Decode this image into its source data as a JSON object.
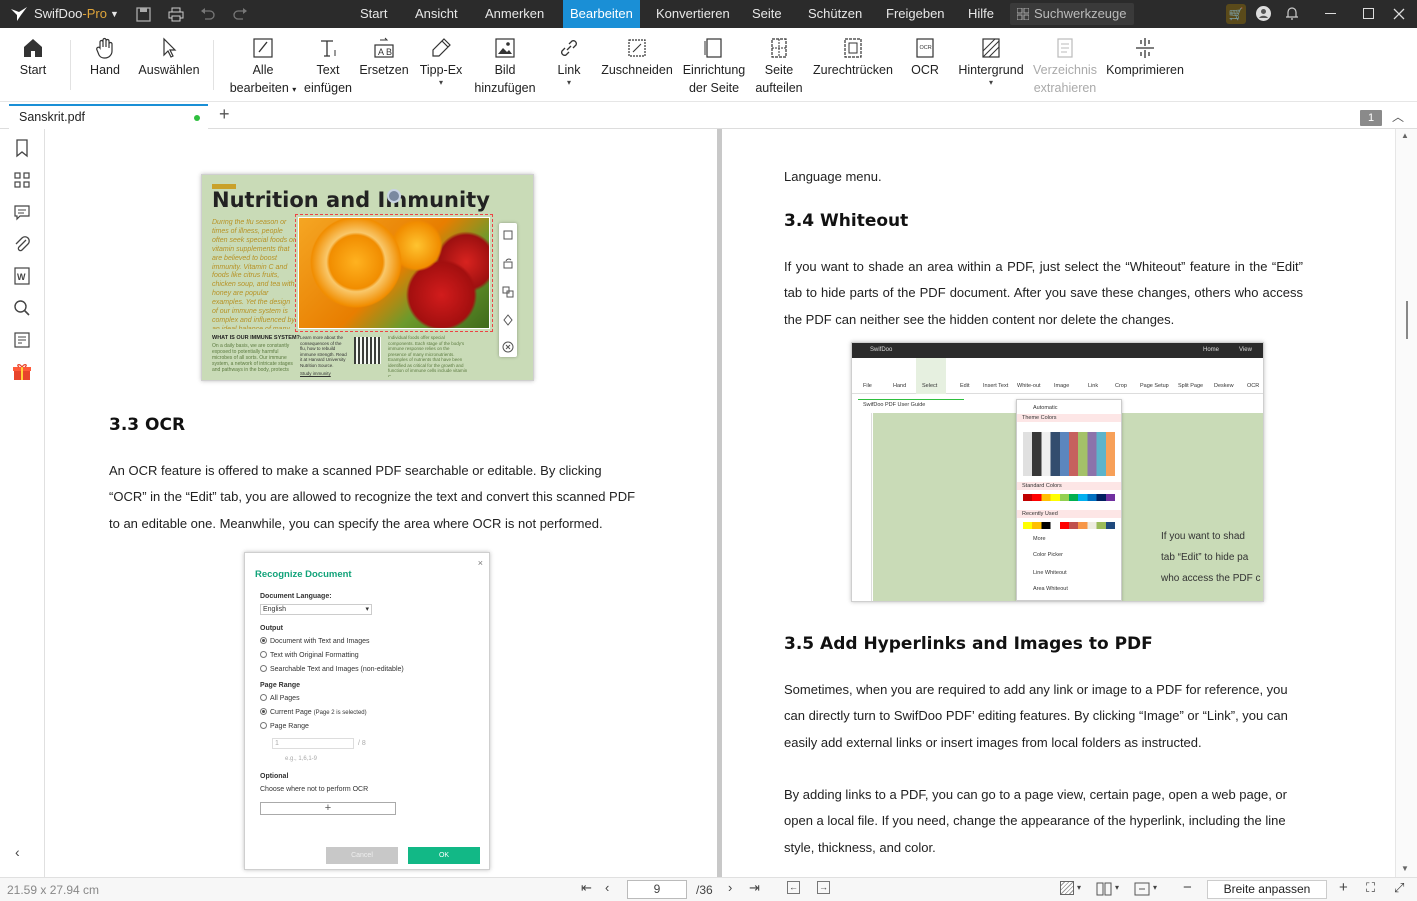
{
  "app": {
    "name": "SwifDoo",
    "edition": "-Pro",
    "search_placeholder": "Suchwerkzeuge"
  },
  "menu": [
    "Start",
    "Ansicht",
    "Anmerken",
    "Bearbeiten",
    "Konvertieren",
    "Seite",
    "Schützen",
    "Freigeben",
    "Hilfe"
  ],
  "active_menu": "Bearbeiten",
  "ribbon": [
    {
      "label": "Start",
      "label2": "",
      "icon": "home-icon"
    },
    {
      "label": "Hand",
      "label2": "",
      "icon": "hand-icon"
    },
    {
      "label": "Auswählen",
      "label2": "",
      "icon": "cursor-icon"
    },
    {
      "label": "Alle",
      "label2": "bearbeiten",
      "icon": "edit-all-icon",
      "dropdown": true
    },
    {
      "label": "Text",
      "label2": "einfügen",
      "icon": "text-insert-icon"
    },
    {
      "label": "Ersetzen",
      "label2": "",
      "icon": "replace-icon"
    },
    {
      "label": "Tipp-Ex",
      "label2": "",
      "icon": "whiteout-icon",
      "dropdown": true
    },
    {
      "label": "Bild",
      "label2": "hinzufügen",
      "icon": "image-add-icon"
    },
    {
      "label": "Link",
      "label2": "",
      "icon": "link-icon",
      "dropdown": true
    },
    {
      "label": "Zuschneiden",
      "label2": "",
      "icon": "crop-icon"
    },
    {
      "label": "Einrichtung",
      "label2": "der Seite",
      "icon": "page-setup-icon"
    },
    {
      "label": "Seite",
      "label2": "aufteilen",
      "icon": "split-page-icon"
    },
    {
      "label": "Zurechtrücken",
      "label2": "",
      "icon": "deskew-icon"
    },
    {
      "label": "OCR",
      "label2": "",
      "icon": "ocr-icon"
    },
    {
      "label": "Hintergrund",
      "label2": "",
      "icon": "background-icon",
      "dropdown": true
    },
    {
      "label": "Verzeichnis",
      "label2": "extrahieren",
      "icon": "extract-toc-icon",
      "disabled": true
    },
    {
      "label": "Komprimieren",
      "label2": "",
      "icon": "compress-icon"
    }
  ],
  "tab": {
    "filename": "Sanskrit.pdf",
    "page_badge": "1"
  },
  "left_page": {
    "fig1": {
      "title": "Nutrition and Immunity",
      "side_text": "During the flu season or times of illness, people often seek special foods or vitamin supplements that are believed to boost immunity. Vitamin C and foods like citrus fruits, chicken soup, and tea with honey are popular examples. Yet the design of our immune system is complex and influenced by an ideal balance of many factors.",
      "bottom_heading": "WHAT IS OUR IMMUNE SYSTEM?",
      "bottom_text": "On a daily basis, we are constantly exposed to potentially harmful microbes of all sorts. Our immune system, a network of intricate stages and pathways in the body, protects",
      "mid_text": "Learn more about the consequences of the flu, how to rebuild immune strength. Read it at Harvard University Nutrition Source.",
      "mid_link": "Study immunity",
      "right_text": "Individual foods offer special components. Each stage of the body's immune response relies on the presence of many micronutrients. Examples of nutrients that have been identified as critical for the growth and function of immune cells include vitamin C."
    },
    "heading": "3.3 OCR",
    "para": "An OCR feature is offered to make a scanned PDF searchable or editable. By clicking “OCR” in the “Edit” tab, you are allowed to recognize the text and convert this scanned PDF to an editable one. Meanwhile, you can specify the area where OCR is not performed.",
    "dialog": {
      "title": "Recognize Document",
      "lang_label": "Document Language:",
      "lang_value": "English",
      "output_label": "Output",
      "output_options": [
        "Document with Text and Images",
        "Text with Original Formatting",
        "Searchable Text and Images (non-editable)"
      ],
      "range_label": "Page Range",
      "range_options": [
        "All Pages",
        "Current Page",
        "Page Range"
      ],
      "current_note": "(Page 2 is selected)",
      "range_value": "1",
      "range_total": "/ 8",
      "range_eg": "e.g., 1,6,1-9",
      "optional_label": "Optional",
      "optional_text": "Choose where not to perform OCR",
      "cancel": "Cancel",
      "ok": "OK"
    }
  },
  "right_page": {
    "top_line": "Language menu.",
    "h1": "3.4 Whiteout",
    "p1": "If you want to shade an area within a PDF, just select the “Whiteout” feature in the “Edit” tab to hide parts of the PDF document. After you save these changes, others who access the PDF can neither see the hidden content nor delete the changes.",
    "fig": {
      "app": "SwifDoo",
      "menu": [
        "Home",
        "View"
      ],
      "tools": [
        "File",
        "Hand",
        "Select",
        "Edit",
        "Insert Text",
        "White-out",
        "Image",
        "Link",
        "Crop",
        "Page Setup",
        "Split Page",
        "Deskew",
        "OCR"
      ],
      "tab": "SwifDoo PDF User Guide",
      "dropdown": [
        "Automatic",
        "Theme Colors",
        "Standard Colors",
        "Recently Used",
        "More",
        "Color Picker",
        "Line Whiteout",
        "Area Whiteout"
      ],
      "snippet": [
        "If you want to shad",
        "tab “Edit” to hide pa",
        "who access the PDF c"
      ]
    },
    "h2": "3.5 Add Hyperlinks and Images to PDF",
    "p2": "Sometimes, when you are required to add any link or image to a PDF for reference, you can directly turn to SwifDoo PDF’ editing features. By clicking “Image” or “Link”, you can easily add external links or insert images from local folders as instructed.",
    "p3": "By adding links to a PDF, you can go to a page view, certain page, open a web page, or open a local file. If you need, change the appearance of the hyperlink, including the line style, thickness, and color."
  },
  "status": {
    "dimensions": "21.59 x 27.94 cm",
    "current_page": "9",
    "total_pages": "/36",
    "zoom_mode": "Breite anpassen"
  },
  "colors": {
    "accent": "#1a8fd6",
    "titlebar": "#2b2b2b",
    "ok_green": "#12b886",
    "figure_bg": "#c9dbb7"
  }
}
